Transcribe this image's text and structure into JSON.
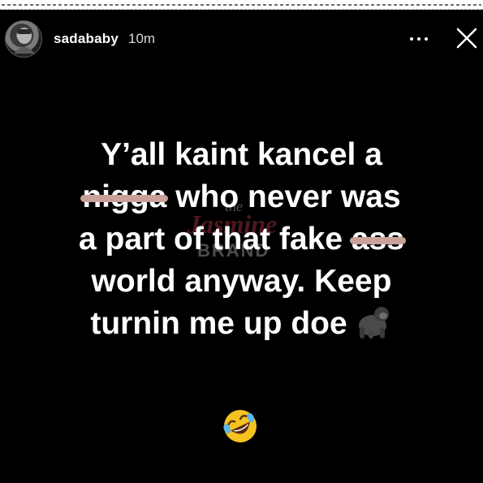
{
  "story": {
    "username": "sadababy",
    "timestamp": "10m",
    "more_icon": "more-options-icon",
    "close_icon": "close-icon",
    "background_color": "#000000"
  },
  "caption": {
    "line1": "Y’all kaint kancel a",
    "line2_struck": "nigga",
    "line2_rest": " who never was",
    "line3_start": "a part of that fake ",
    "line3_struck": "ass",
    "line4": "world anyway. Keep",
    "line5": "turnin me up doe",
    "emoji_1": "gorilla-emoji",
    "emoji_2": "rolling-on-floor-laughing-emoji",
    "strike_color": "#c9a19a"
  },
  "watermark": {
    "the": "the",
    "name": "Jasmine",
    "brand": "BRAND"
  }
}
